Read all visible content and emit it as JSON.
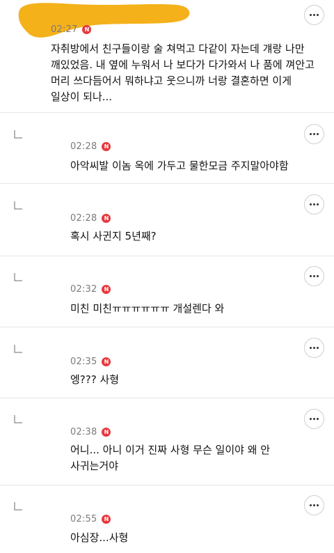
{
  "comments": [
    {
      "time": "02:27",
      "badge": "N",
      "text": "자취방에서 친구들이랑 술 쳐먹고 다같이 자는데 걔랑 나만\n깨있었음. 내 옆에 누워서 나 보다가 다가와서 나 품에 껴안고\n머리 쓰다듬어서 뭐하냐고 웃으니까 너랑 결혼하면 이게\n일상이 되나..."
    },
    {
      "time": "02:28",
      "badge": "N",
      "text": "아악씨발 이놈 옥에 가두고 물한모금 주지말아야함"
    },
    {
      "time": "02:28",
      "badge": "N",
      "text": "혹시 사귄지 5년째?"
    },
    {
      "time": "02:32",
      "badge": "N",
      "text": "미친 미친ㅠㅠㅠㅠㅠㅠ 개설렌다 와"
    },
    {
      "time": "02:35",
      "badge": "N",
      "text": "엥??? 사형"
    },
    {
      "time": "02:38",
      "badge": "N",
      "text": "어니... 아니 이거 진짜 사형 무슨 일이야 왜 안\n사귀는거야"
    },
    {
      "time": "02:55",
      "badge": "N",
      "text": "아심장...사형"
    }
  ],
  "colors": {
    "badge": "#e8383d",
    "avatar_blob": "#f4b11a"
  },
  "icons": {
    "more": "more-dots-icon",
    "reply": "reply-arrow-icon"
  }
}
